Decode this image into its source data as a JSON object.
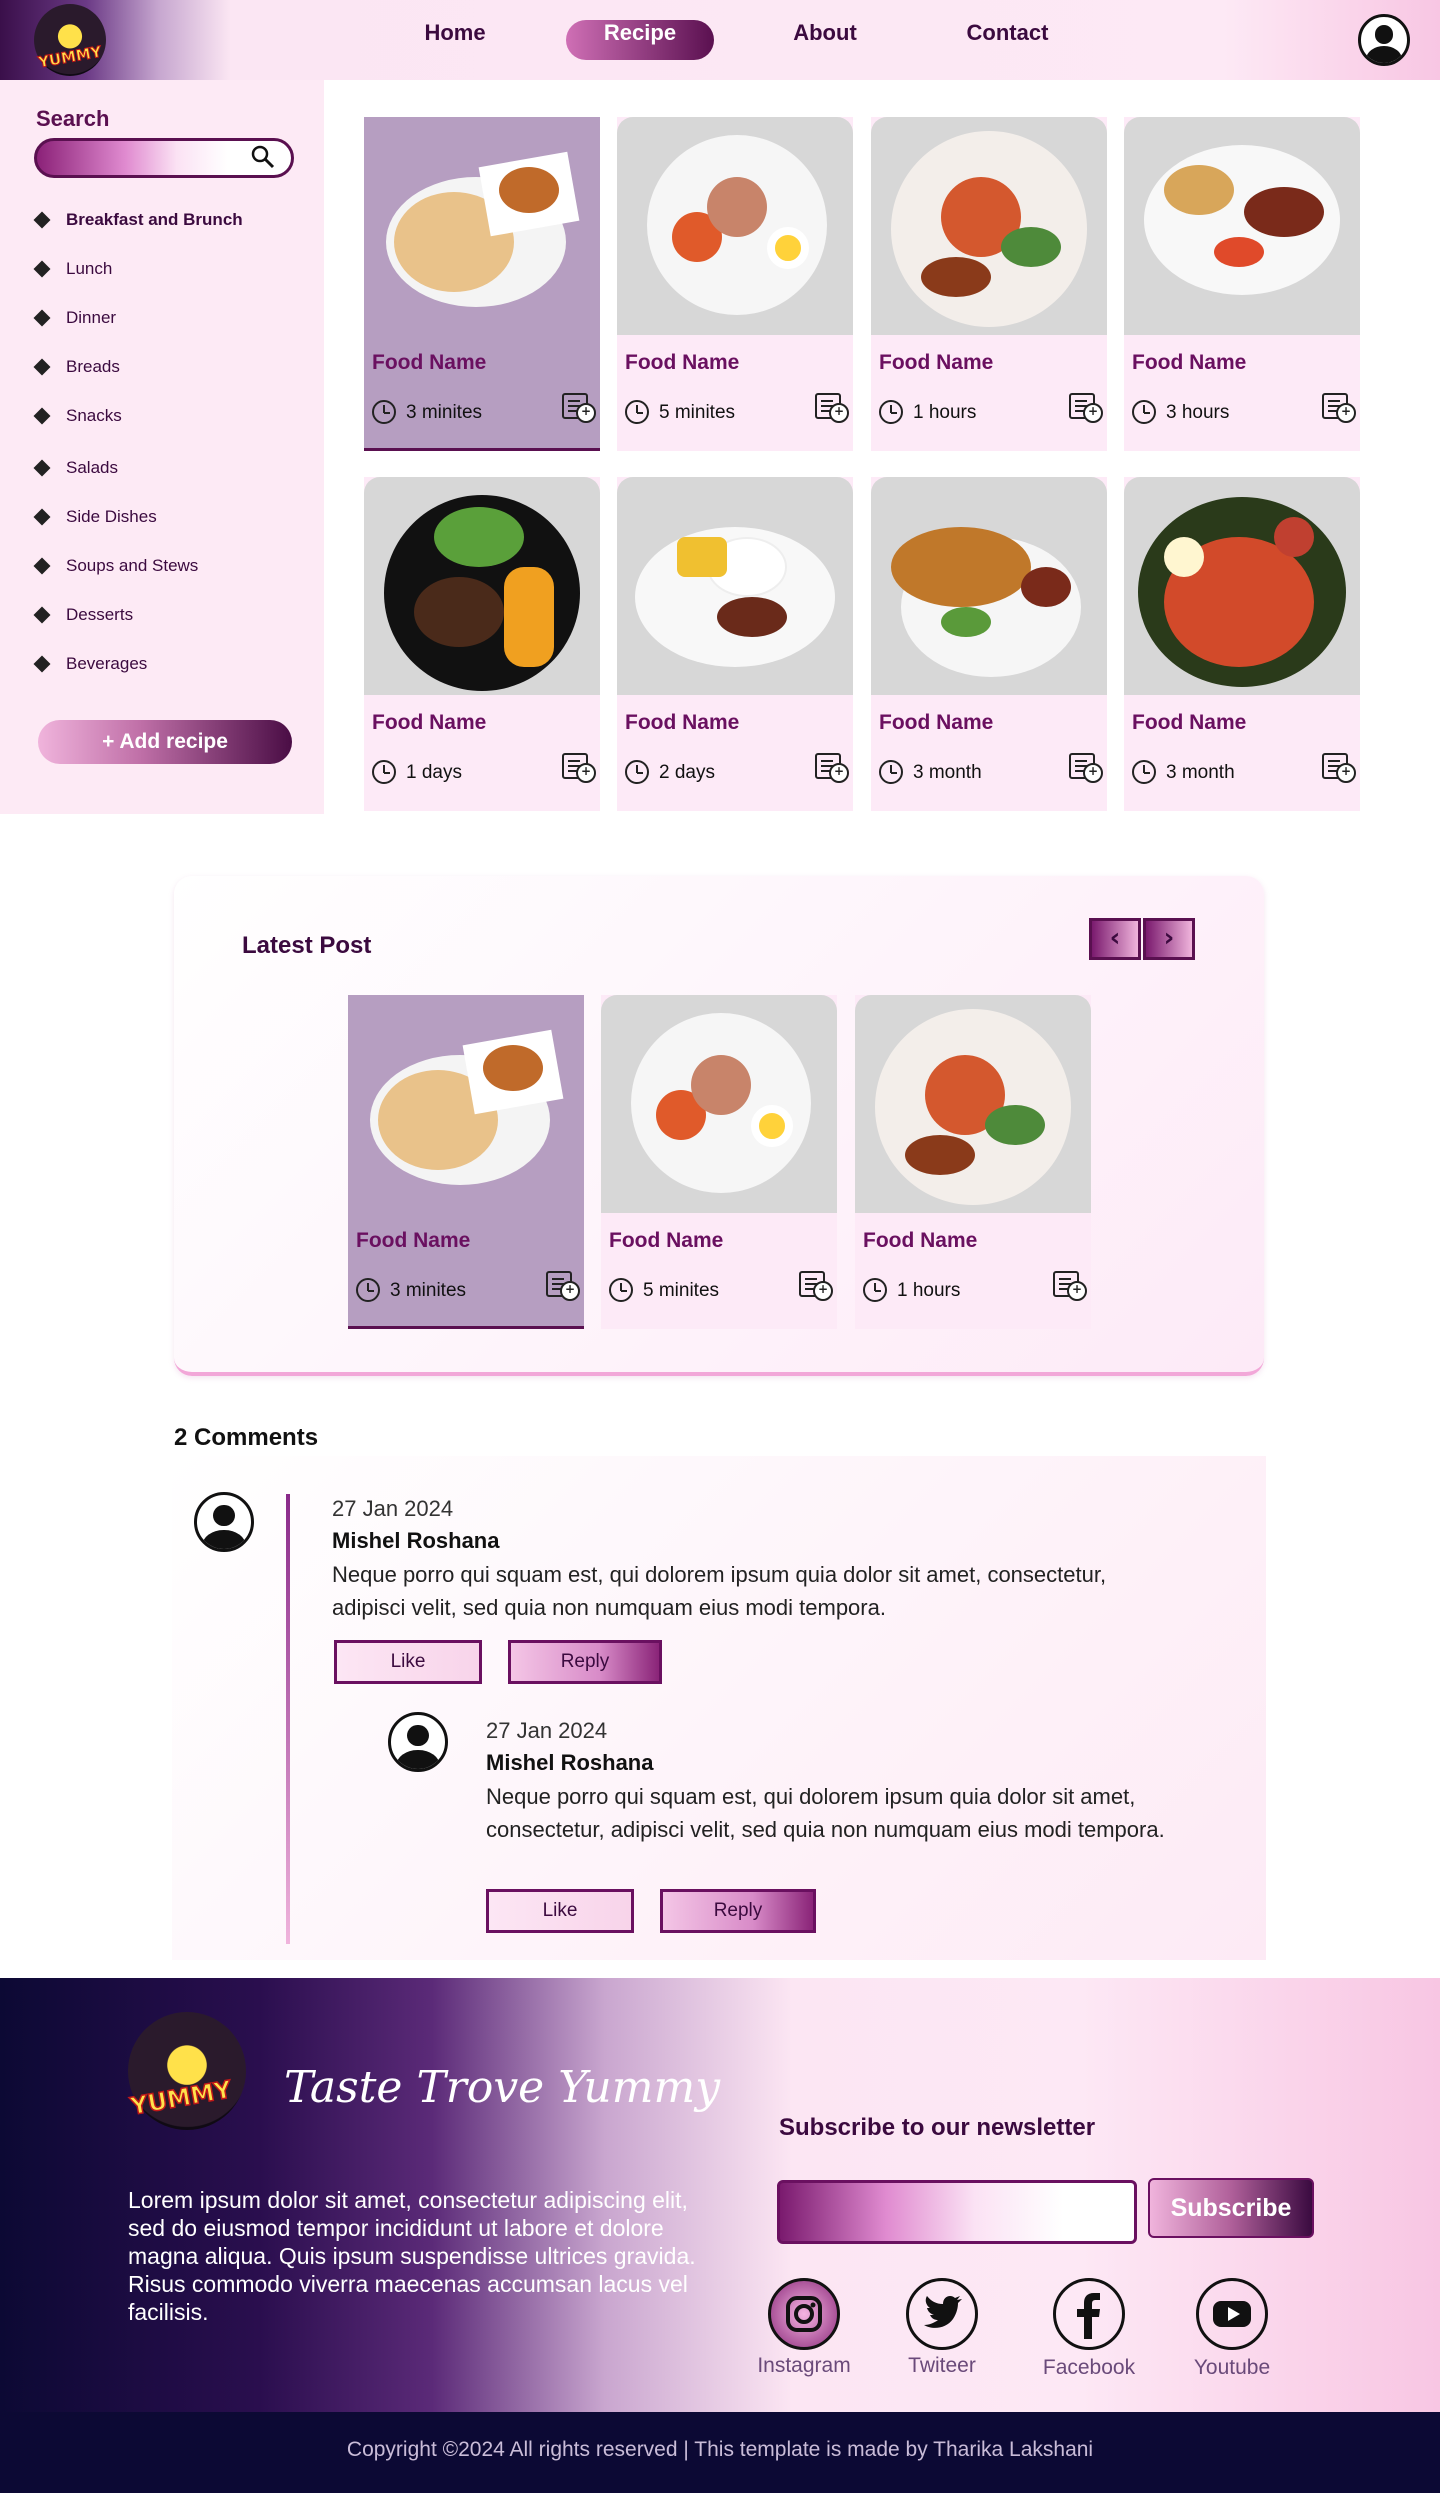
{
  "header": {
    "logo_text": "YUMMY",
    "nav": [
      "Home",
      "Recipe",
      "About",
      "Contact"
    ],
    "active_nav": "Recipe"
  },
  "sidebar": {
    "search_label": "Search",
    "categories": [
      "Breakfast and Brunch",
      "Lunch",
      "Dinner",
      "Breads",
      "Snacks",
      "Salads",
      "Side Dishes",
      "Soups and Stews",
      "Desserts",
      "Beverages"
    ],
    "add_recipe": "+ Add recipe"
  },
  "recipes": [
    {
      "name": "Food Name",
      "time": "3 minites"
    },
    {
      "name": "Food Name",
      "time": "5 minites"
    },
    {
      "name": "Food Name",
      "time": "1 hours"
    },
    {
      "name": "Food Name",
      "time": "3 hours"
    },
    {
      "name": "Food Name",
      "time": "1 days"
    },
    {
      "name": "Food Name",
      "time": "2 days"
    },
    {
      "name": "Food Name",
      "time": "3 month"
    },
    {
      "name": "Food Name",
      "time": "3 month"
    }
  ],
  "latest": {
    "title": "Latest Post",
    "posts": [
      {
        "name": "Food Name",
        "time": "3 minites"
      },
      {
        "name": "Food Name",
        "time": "5 minites"
      },
      {
        "name": "Food Name",
        "time": "1 hours"
      }
    ]
  },
  "comments": {
    "title": "2 Comments",
    "items": [
      {
        "date": "27 Jan 2024",
        "author": "Mishel Roshana",
        "text": "Neque porro qui squam est, qui dolorem ipsum quia dolor sit amet, consectetur, adipisci velit, sed quia non numquam eius modi tempora.",
        "like": "Like",
        "reply": "Reply"
      },
      {
        "date": "27 Jan 2024",
        "author": "Mishel Roshana",
        "text": "Neque porro qui squam est, qui dolorem ipsum quia dolor sit amet, consectetur, adipisci velit, sed quia non numquam eius modi tempora.",
        "like": "Like",
        "reply": "Reply"
      }
    ]
  },
  "footer": {
    "logo_text": "YUMMY",
    "brand": "Taste Trove Yummy",
    "text": "Lorem ipsum dolor sit amet, consectetur adipiscing elit, sed do eiusmod tempor incididunt ut labore et dolore magna aliqua. Quis ipsum suspendisse ultrices gravida. Risus commodo viverra maecenas accumsan lacus vel facilisis.",
    "newsletter_title": "Subscribe to our newsletter",
    "newsletter_placeholder": "",
    "subscribe": "Subscribe",
    "social": [
      {
        "label": "Instagram",
        "icon": "instagram-icon"
      },
      {
        "label": "Twiteer",
        "icon": "twitter-icon"
      },
      {
        "label": "Facebook",
        "icon": "facebook-icon"
      },
      {
        "label": "Youtube",
        "icon": "youtube-icon"
      }
    ],
    "copyright": "Copyright ©2024 All rights reserved | This template is made by Tharika Lakshani"
  },
  "colors": {
    "brand_dark": "#5a1050",
    "accent_pink": "#fdeaf7",
    "footer_dark": "#0c0934"
  }
}
